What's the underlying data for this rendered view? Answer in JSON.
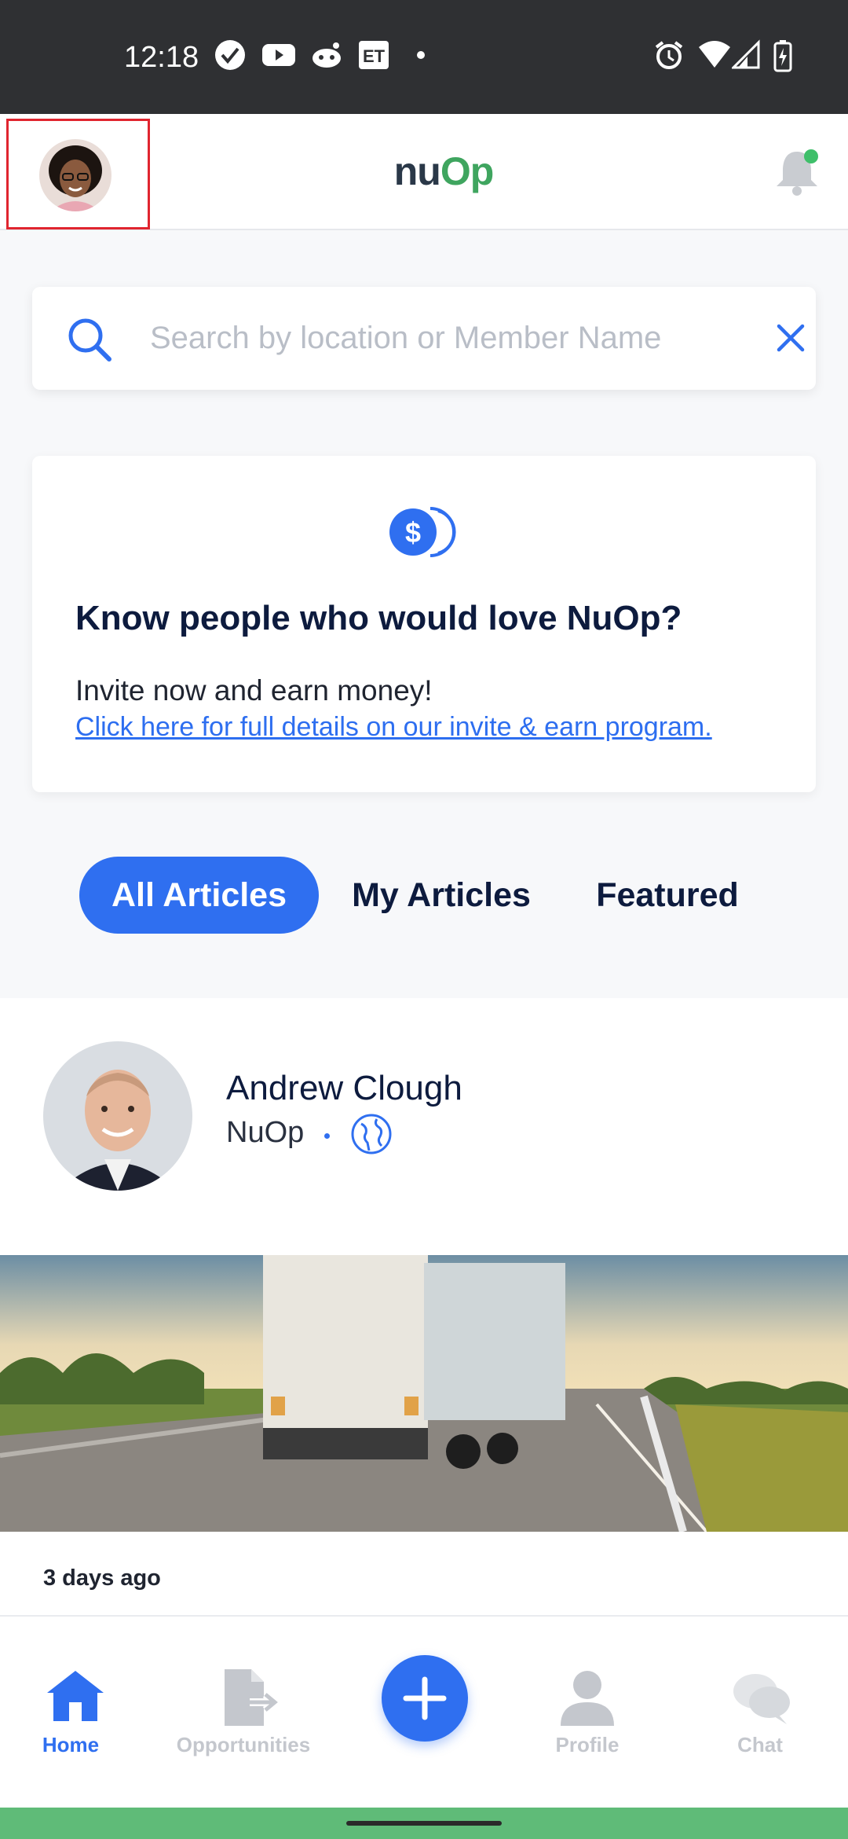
{
  "status_bar": {
    "time": "12:18",
    "left_icons": [
      "check-circle-icon",
      "youtube-icon",
      "reddit-icon",
      "et-icon",
      "dot-icon"
    ],
    "right_icons": [
      "alarm-icon",
      "wifi-icon",
      "signal-icon",
      "battery-charging-icon"
    ]
  },
  "app_bar": {
    "logo_text": "NuOp",
    "notification_dot_color": "#3fbf6a"
  },
  "search": {
    "placeholder": "Search by location or Member Name"
  },
  "promo": {
    "title": "Know people who would love NuOp?",
    "description": "Invite now and earn money!",
    "link": "Click here for full details on our invite & earn program."
  },
  "tabs": [
    {
      "label": "All Articles",
      "active": true
    },
    {
      "label": "My Articles",
      "active": false
    },
    {
      "label": "Featured",
      "active": false
    }
  ],
  "article": {
    "author": "Andrew Clough",
    "organization": "NuOp",
    "posted": "3 days ago"
  },
  "bottom_nav": [
    {
      "label": "Home",
      "active": true
    },
    {
      "label": "Opportunities",
      "active": false
    },
    {
      "label": "Profile",
      "active": false
    },
    {
      "label": "Chat",
      "active": false
    }
  ],
  "colors": {
    "accent": "#2f6ff0",
    "brand_green": "#3fa55f",
    "text_dark": "#0d1b3e"
  }
}
